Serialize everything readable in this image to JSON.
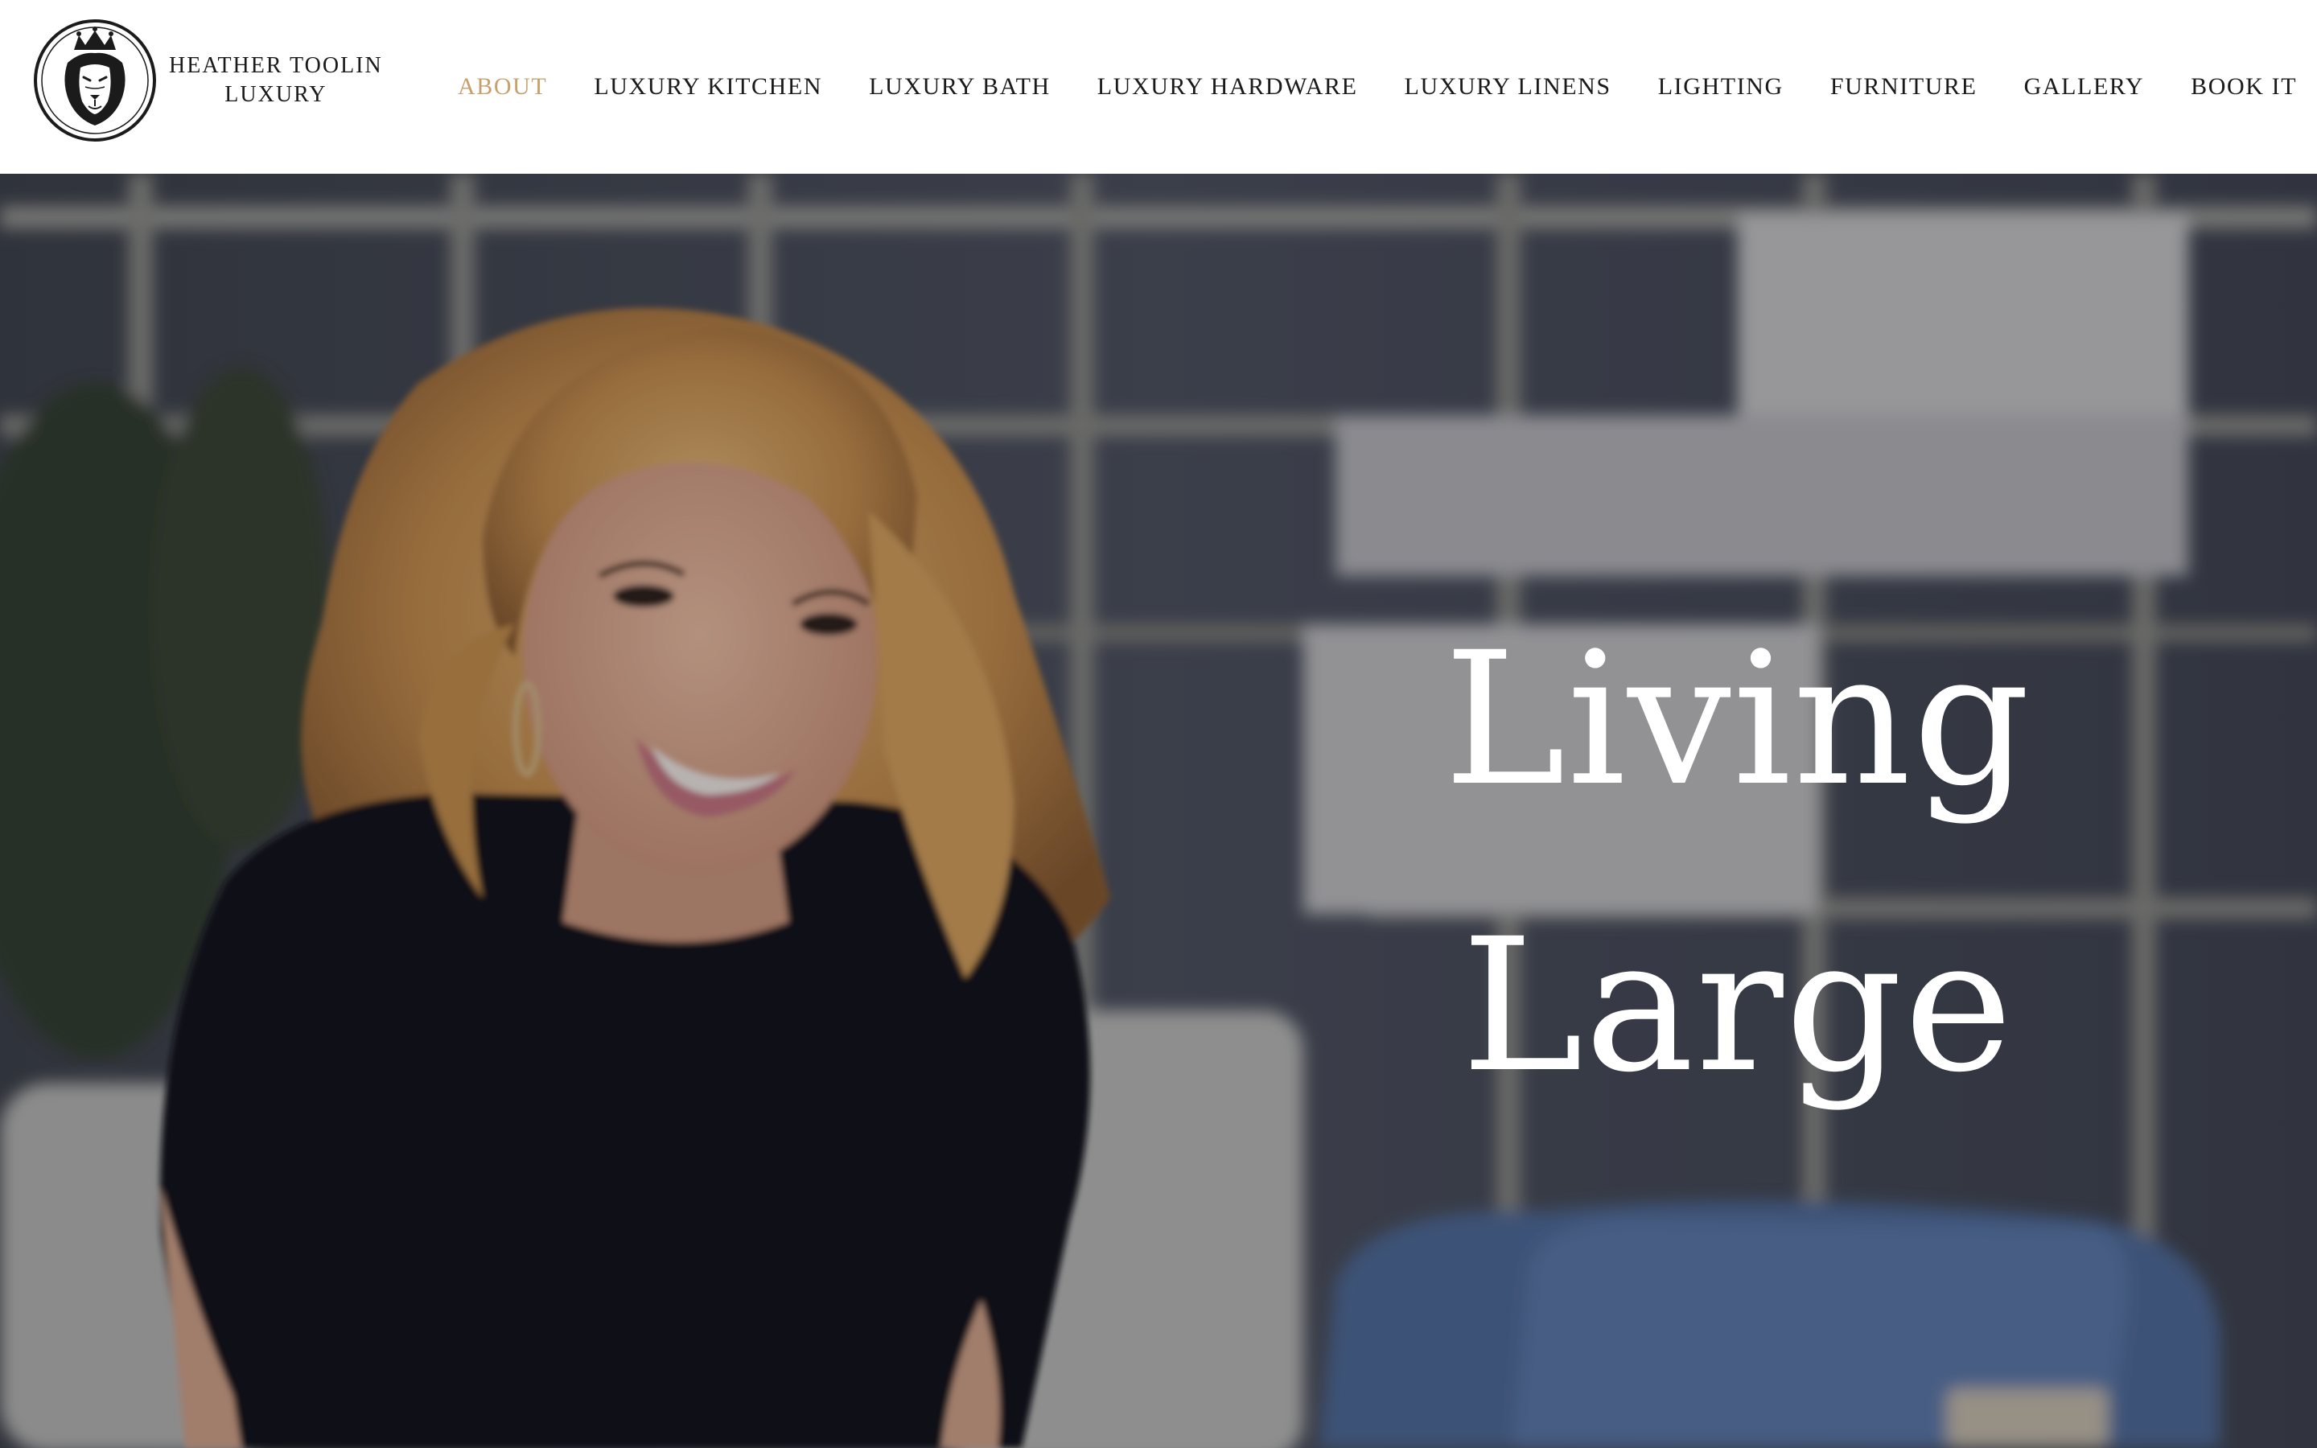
{
  "brand": {
    "line1": "HEATHER TOOLIN",
    "line2": "LUXURY",
    "logo_icon": "lion-crown-icon"
  },
  "nav": {
    "items": [
      {
        "label": "ABOUT",
        "active": true
      },
      {
        "label": "LUXURY KITCHEN",
        "active": false
      },
      {
        "label": "LUXURY BATH",
        "active": false
      },
      {
        "label": "LUXURY HARDWARE",
        "active": false
      },
      {
        "label": "LUXURY LINENS",
        "active": false
      },
      {
        "label": "LIGHTING",
        "active": false
      },
      {
        "label": "FURNITURE",
        "active": false
      },
      {
        "label": "GALLERY",
        "active": false
      },
      {
        "label": "BOOK IT",
        "active": false
      }
    ]
  },
  "hero": {
    "line1": "Living",
    "line2": "Large"
  },
  "colors": {
    "active_nav": "#c7a06a",
    "text": "#1a1a1a",
    "hero_text": "#ffffff",
    "header_bg": "#ffffff"
  }
}
